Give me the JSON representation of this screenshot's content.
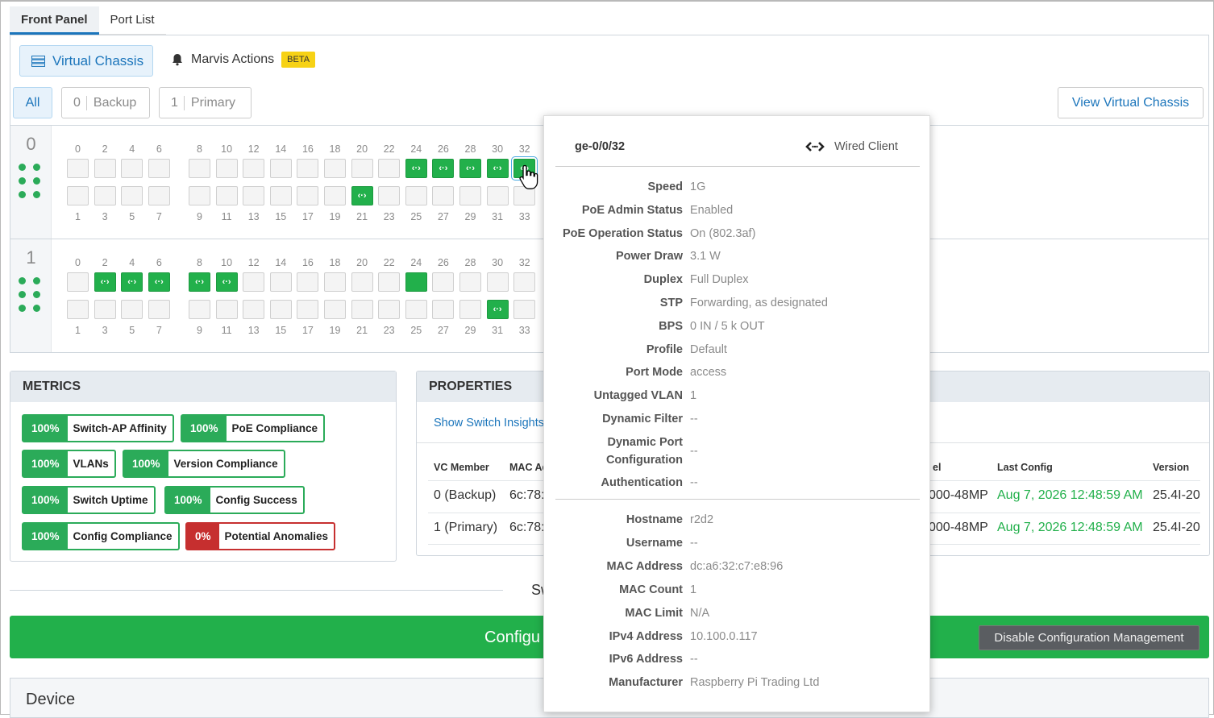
{
  "tabs": {
    "front_panel": "Front Panel",
    "port_list": "Port List"
  },
  "toolbar": {
    "virtual_chassis": "Virtual Chassis",
    "marvis_actions": "Marvis Actions",
    "beta": "BETA",
    "view_virtual_chassis": "View Virtual Chassis"
  },
  "filters": {
    "all": "All",
    "backup_count": "0",
    "backup": "Backup",
    "primary_count": "1",
    "primary": "Primary"
  },
  "members": [
    {
      "number": "0",
      "top_labels": [
        "0",
        "2",
        "4",
        "6",
        "8",
        "10",
        "12",
        "14",
        "16",
        "18",
        "20",
        "22",
        "24",
        "26",
        "28",
        "30",
        "32"
      ],
      "bottom_labels": [
        "1",
        "3",
        "5",
        "7",
        "9",
        "11",
        "13",
        "15",
        "17",
        "19",
        "21",
        "23",
        "25",
        "27",
        "29",
        "31",
        "33"
      ],
      "top_up": [
        "24",
        "26",
        "28",
        "30",
        "32"
      ],
      "bottom_up": [
        "21"
      ],
      "selected": "32"
    },
    {
      "number": "1",
      "top_labels": [
        "0",
        "2",
        "4",
        "6",
        "8",
        "10",
        "12",
        "14",
        "16",
        "18",
        "20",
        "22",
        "24",
        "26",
        "28",
        "30",
        "32"
      ],
      "bottom_labels": [
        "1",
        "3",
        "5",
        "7",
        "9",
        "11",
        "13",
        "15",
        "17",
        "19",
        "21",
        "23",
        "25",
        "27",
        "29",
        "31",
        "33"
      ],
      "top_up": [
        "2",
        "4",
        "6",
        "8",
        "10",
        "24"
      ],
      "top_plain_up": [
        "24"
      ],
      "bottom_up": [
        "31"
      ]
    }
  ],
  "metrics": {
    "title": "METRICS",
    "items": [
      {
        "pct": "100%",
        "label": "Switch-AP Affinity"
      },
      {
        "pct": "100%",
        "label": "PoE Compliance"
      },
      {
        "pct": "100%",
        "label": "VLANs"
      },
      {
        "pct": "100%",
        "label": "Version Compliance"
      },
      {
        "pct": "100%",
        "label": "Switch Uptime"
      },
      {
        "pct": "100%",
        "label": "Config Success"
      },
      {
        "pct": "100%",
        "label": "Config Compliance"
      },
      {
        "pct": "0%",
        "label": "Potential Anomalies"
      }
    ]
  },
  "properties": {
    "title": "PROPERTIES",
    "insights_link": "Show Switch Insights",
    "headers": {
      "vc_member": "VC Member",
      "mac": "MAC Ad",
      "model": "el",
      "last_config": "Last Config",
      "version": "Version"
    },
    "rows": [
      {
        "vc_member": "0 (Backup)",
        "mac": "6c:78:",
        "model": "000-48MP",
        "last_config": "Aug 7, 2026 12:48:59 AM",
        "version": "25.4I-20"
      },
      {
        "vc_member": "1 (Primary)",
        "mac": "6c:78:",
        "model": "000-48MP",
        "last_config": "Aug 7, 2026 12:48:59 AM",
        "version": "25.4I-20"
      }
    ]
  },
  "section_title_partial": "Sw",
  "config_bar": {
    "text_partial": "Configu",
    "disable_button": "Disable Configuration Management"
  },
  "device": {
    "title": "Device"
  },
  "popover": {
    "port_name": "ge-0/0/32",
    "client_type": "Wired Client",
    "client_icon": "wired-client-icon",
    "fields": [
      {
        "key": "Speed",
        "value": "1G"
      },
      {
        "key": "PoE Admin Status",
        "value": "Enabled"
      },
      {
        "key": "PoE Operation Status",
        "value": "On (802.3af)"
      },
      {
        "key": "Power Draw",
        "value": "3.1 W"
      },
      {
        "key": "Duplex",
        "value": "Full Duplex"
      },
      {
        "key": "STP",
        "value": "Forwarding, as designated"
      },
      {
        "key": "BPS",
        "value": "0 IN / 5 k OUT"
      },
      {
        "key": "Profile",
        "value": "Default"
      },
      {
        "key": "Port Mode",
        "value": "access"
      },
      {
        "key": "Untagged VLAN",
        "value": "1"
      },
      {
        "key": "Dynamic Filter",
        "value": "--"
      },
      {
        "key": "Dynamic Port Configuration",
        "value": "--"
      },
      {
        "key": "Authentication",
        "value": "--"
      }
    ],
    "client_fields": [
      {
        "key": "Hostname",
        "value": "r2d2"
      },
      {
        "key": "Username",
        "value": "--"
      },
      {
        "key": "MAC Address",
        "value": "dc:a6:32:c7:e8:96"
      },
      {
        "key": "MAC Count",
        "value": "1"
      },
      {
        "key": "MAC Limit",
        "value": "N/A"
      },
      {
        "key": "IPv4 Address",
        "value": "10.100.0.117"
      },
      {
        "key": "IPv6 Address",
        "value": "--"
      },
      {
        "key": "Manufacturer",
        "value": "Raspberry Pi Trading Ltd"
      }
    ]
  },
  "colors": {
    "accent": "#1b75bb",
    "green": "#22b04b",
    "red": "#c62f2f",
    "beta": "#f7d215"
  }
}
